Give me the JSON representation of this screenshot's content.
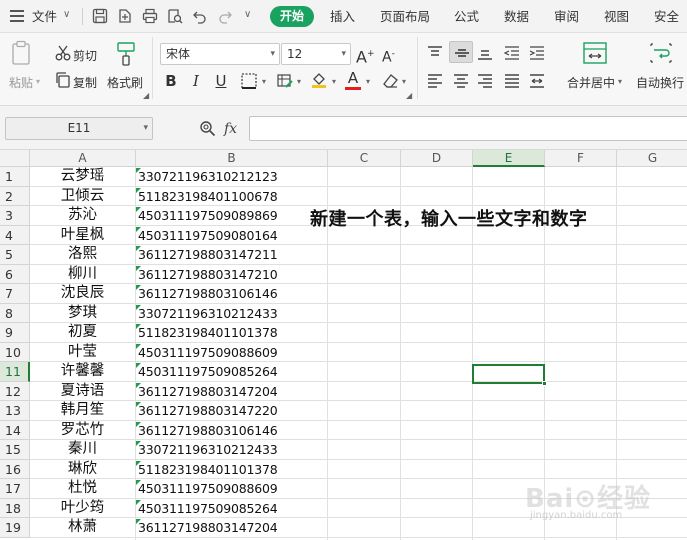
{
  "menubar": {
    "file": "文件",
    "tabs": [
      "开始",
      "插入",
      "页面布局",
      "公式",
      "数据",
      "审阅",
      "视图",
      "安全"
    ]
  },
  "ribbon": {
    "paste": "粘贴",
    "cut": "剪切",
    "copy": "复制",
    "format_painter": "格式刷",
    "font_name": "宋体",
    "font_size": "12",
    "merge_center": "合并居中",
    "wrap_text": "自动换行"
  },
  "formula_bar": {
    "name_box": "E11",
    "fx": "fx",
    "formula": ""
  },
  "grid": {
    "columns": [
      "A",
      "B",
      "C",
      "D",
      "E",
      "F",
      "G"
    ],
    "selected_column": "E",
    "selected_row": "11",
    "rows": [
      {
        "num": "1",
        "a": "云梦瑶",
        "b": "330721196310212123"
      },
      {
        "num": "2",
        "a": "卫倾云",
        "b": "511823198401100678"
      },
      {
        "num": "3",
        "a": "苏沁",
        "b": "450311197509089869"
      },
      {
        "num": "4",
        "a": "叶星枫",
        "b": "450311197509080164"
      },
      {
        "num": "5",
        "a": "洛熙",
        "b": "361127198803147211"
      },
      {
        "num": "6",
        "a": "柳川",
        "b": "361127198803147210"
      },
      {
        "num": "7",
        "a": "沈良辰",
        "b": "361127198803106146"
      },
      {
        "num": "8",
        "a": "梦琪",
        "b": "330721196310212433"
      },
      {
        "num": "9",
        "a": "初夏",
        "b": "511823198401101378"
      },
      {
        "num": "10",
        "a": "叶莹",
        "b": "450311197509088609"
      },
      {
        "num": "11",
        "a": "许馨馨",
        "b": "450311197509085264"
      },
      {
        "num": "12",
        "a": "夏诗语",
        "b": "361127198803147204"
      },
      {
        "num": "13",
        "a": "韩月笙",
        "b": "361127198803147220"
      },
      {
        "num": "14",
        "a": "罗芯竹",
        "b": "361127198803106146"
      },
      {
        "num": "15",
        "a": "秦川",
        "b": "330721196310212433"
      },
      {
        "num": "16",
        "a": "琳欣",
        "b": "511823198401101378"
      },
      {
        "num": "17",
        "a": "杜悦",
        "b": "450311197509088609"
      },
      {
        "num": "18",
        "a": "叶少筠",
        "b": "450311197509085264"
      },
      {
        "num": "19",
        "a": "林萧",
        "b": "361127198803147204"
      }
    ],
    "note": "新建一个表，输入一些文字和数字"
  },
  "watermark": {
    "main": "Bai⊙经验",
    "sub": "jingyan.baidu.com"
  },
  "colors": {
    "accent": "#1aa260",
    "selection": "#1e7e34"
  }
}
